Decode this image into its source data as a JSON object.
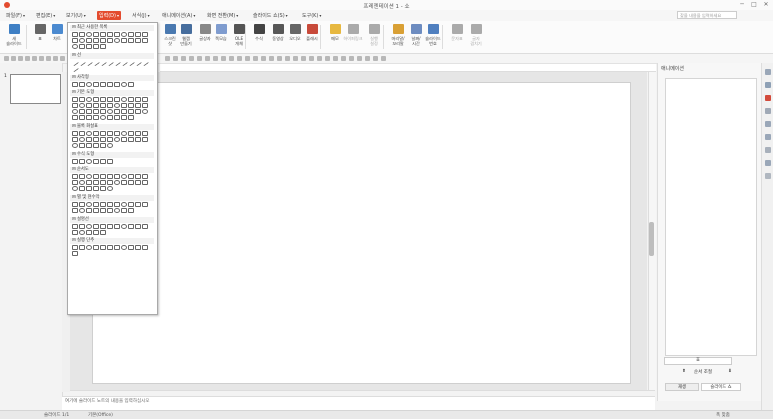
{
  "window": {
    "title": "프레젠테이션 1 - 쇼",
    "min": "─",
    "max": "□",
    "close": "✕"
  },
  "menus": [
    "파일(F)",
    "편집(E)",
    "보기(U)",
    "입력(D)",
    "서식(J)",
    "애니메이션(A)",
    "화면 전환(M)",
    "슬라이드 쇼(S)",
    "도구(K)"
  ],
  "active_menu_index": 3,
  "help_search_placeholder": "찾을 내용을 입력하세요",
  "ribbon": [
    {
      "label": "새\n슬라이드",
      "color": "#3e7fc4"
    },
    {
      "label": "표",
      "color": "#666"
    },
    {
      "label": "차트",
      "color": "#4b8ad0"
    },
    {
      "label": "도형",
      "color": "#5d9bd5"
    },
    {
      "label": "그림",
      "color": "#6aa86a"
    },
    {
      "label": "스마트\n아트",
      "color": "#5778b5"
    },
    {
      "label": "텍스트\n상자",
      "color": "#777"
    },
    {
      "label": "스크린\n샷",
      "color": "#4a79b0"
    },
    {
      "label": "웹캠\n만들기",
      "color": "#476e9e"
    },
    {
      "label": "글상자",
      "color": "#888"
    },
    {
      "label": "쪽모습",
      "color": "#7f9ccf"
    },
    {
      "label": "OLE\n개체",
      "color": "#555"
    },
    {
      "label": "수식",
      "color": "#444"
    },
    {
      "label": "동영상",
      "color": "#575757"
    },
    {
      "label": "오디오",
      "color": "#666"
    },
    {
      "label": "플래시",
      "color": "#c84a3a"
    },
    {
      "label": "메모",
      "color": "#e7b840"
    },
    {
      "label": "하이퍼링크",
      "color": "#aaa",
      "disabled": true
    },
    {
      "label": "실행\n설정",
      "color": "#aaa",
      "disabled": true
    },
    {
      "label": "머리말/\n꼬리말",
      "color": "#d9a035"
    },
    {
      "label": "날짜/\n시간",
      "color": "#6d8cc0"
    },
    {
      "label": "슬라이드\n번호",
      "color": "#4f7fbf"
    },
    {
      "label": "문자표",
      "color": "#aaa",
      "disabled": true
    },
    {
      "label": "글자\n겹치기",
      "color": "#aaa",
      "disabled": true
    }
  ],
  "thumbnail_number": "1",
  "notes_placeholder": "여기에 슬라이드 노트의 내용을 입력하십시오",
  "status": {
    "slide_info": "슬라이드 1/1",
    "theme": "기본(Office)",
    "zoom": "폭 맞춤"
  },
  "taskpane": {
    "title": "애니메이션",
    "order_label": "순서 조절",
    "tab_start": "재생",
    "tab_show": "슬라이드 쇼",
    "field_label": "효"
  },
  "shape_sections": [
    {
      "title": "최근 사용한 목록",
      "count": 27
    },
    {
      "title": "선",
      "count": 12
    },
    {
      "title": "사각형",
      "count": 9
    },
    {
      "title": "기본 도형",
      "count": 42
    },
    {
      "title": "블록 화살표",
      "count": 28
    },
    {
      "title": "수식 도형",
      "count": 6
    },
    {
      "title": "순서도",
      "count": 28
    },
    {
      "title": "별 및 현수막",
      "count": 20
    },
    {
      "title": "설명선",
      "count": 16
    },
    {
      "title": "실행 단추",
      "count": 12
    }
  ]
}
